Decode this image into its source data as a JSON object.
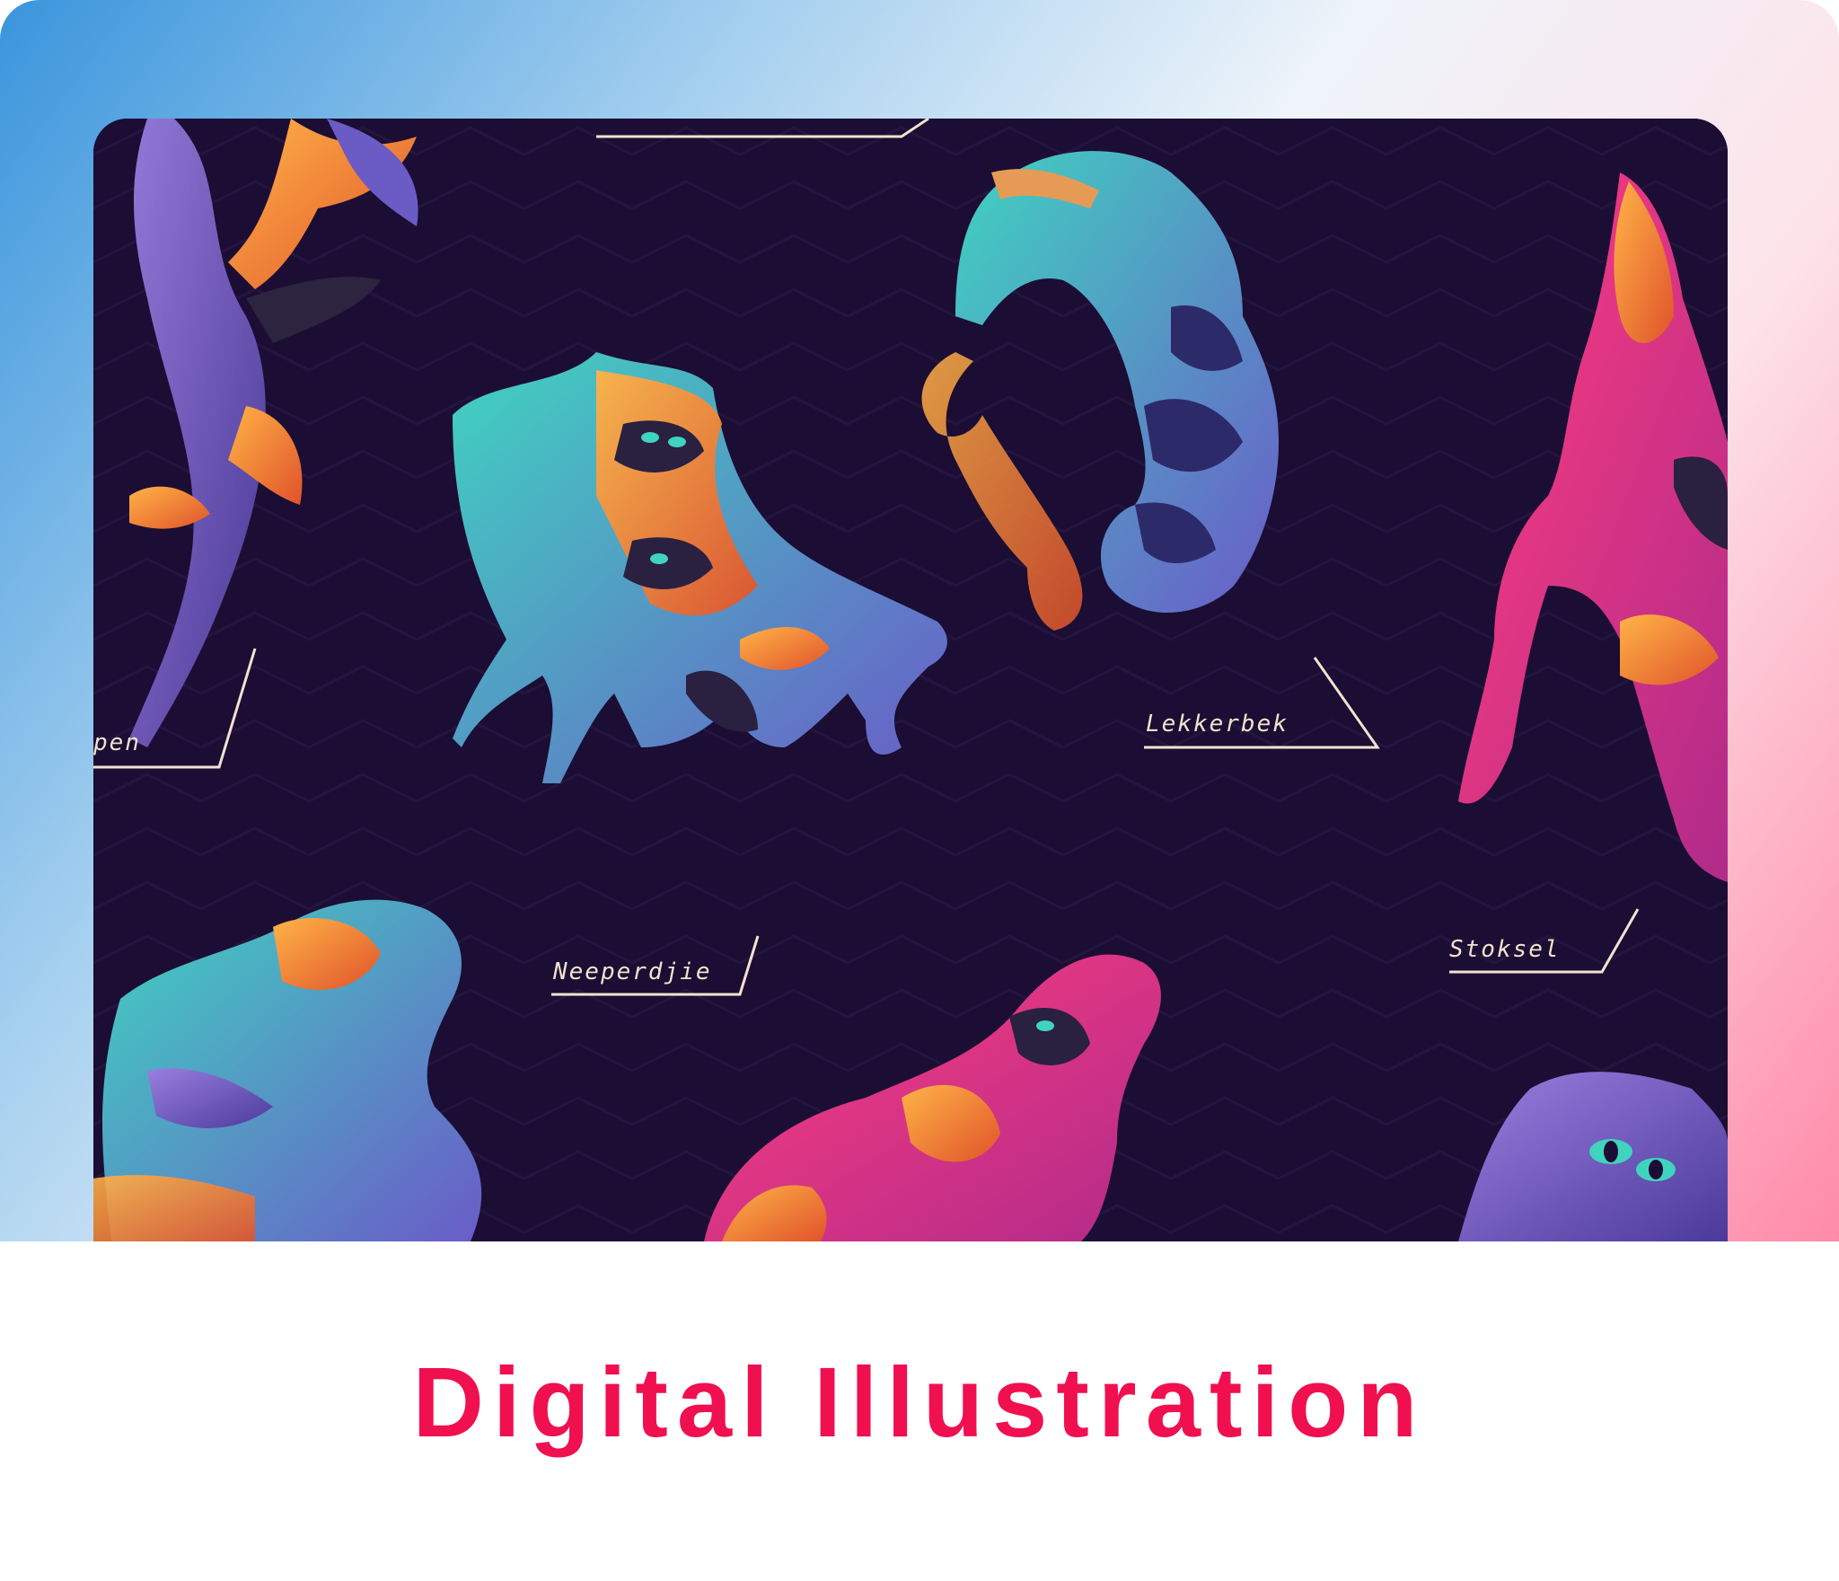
{
  "card": {
    "title": "Digital Illustration",
    "accent_color": "#f0104f",
    "gradient_colors": [
      "#3a95dc",
      "#eef4fa",
      "#fe8aa9"
    ]
  },
  "artwork": {
    "background_color": "#1b0d33",
    "labels": {
      "partial_left": "pen",
      "neeperdjie": "Neeperdjie",
      "lekkerbek": "Lekkerbek",
      "stoksel": "Stoksel"
    }
  }
}
